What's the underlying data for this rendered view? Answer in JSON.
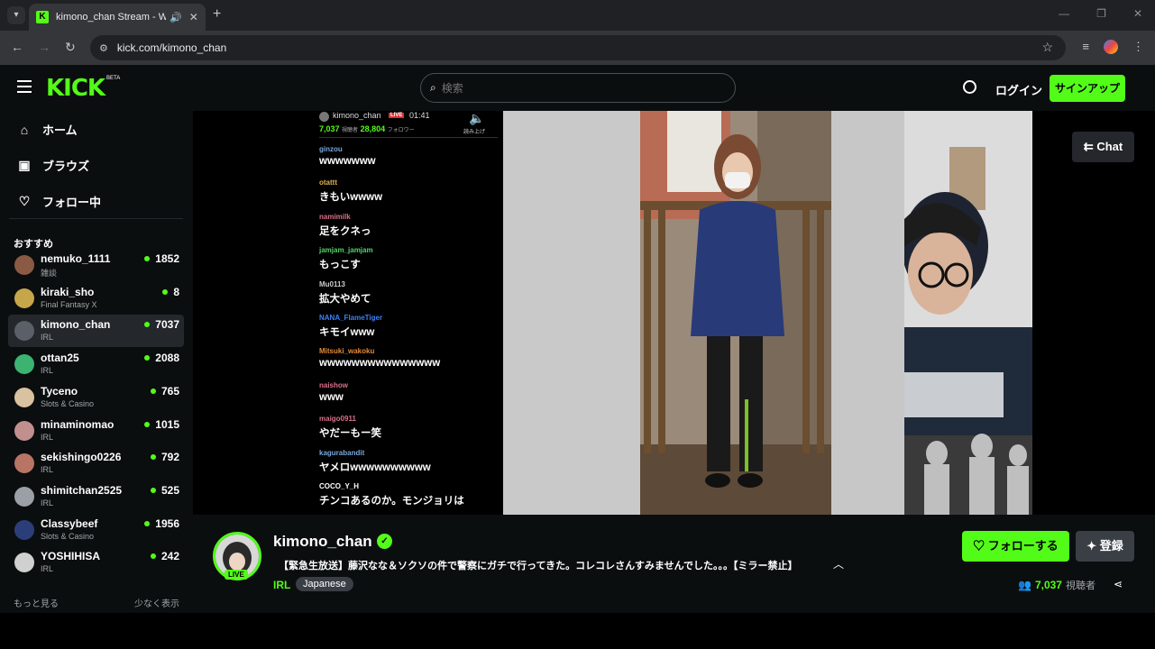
{
  "browser": {
    "tab_title": "kimono_chan Stream - Watch Live on Kick",
    "url": "kick.com/kimono_chan"
  },
  "header": {
    "logo": "KICK",
    "beta": "BETA",
    "search_placeholder": "検索",
    "login": "ログイン",
    "signup": "サインアップ"
  },
  "sidebar": {
    "nav": [
      {
        "label": "ホーム",
        "icon": "home-icon"
      },
      {
        "label": "ブラウズ",
        "icon": "browse-icon"
      },
      {
        "label": "フォロー中",
        "icon": "heart-icon"
      }
    ],
    "recommended_title": "おすすめ",
    "channels": [
      {
        "name": "nemuko_1111",
        "category": "雑談",
        "viewers": "1852",
        "color": "#8a5a44"
      },
      {
        "name": "kiraki_sho",
        "category": "Final Fantasy X",
        "viewers": "8",
        "color": "#c7a64a"
      },
      {
        "name": "kimono_chan",
        "category": "IRL",
        "viewers": "7037",
        "color": "#5a5f68",
        "active": true
      },
      {
        "name": "ottan25",
        "category": "IRL",
        "viewers": "2088",
        "color": "#3cb371"
      },
      {
        "name": "Tyceno",
        "category": "Slots & Casino",
        "viewers": "765",
        "color": "#d9c2a0"
      },
      {
        "name": "minaminomao",
        "category": "IRL",
        "viewers": "1015",
        "color": "#c28f8f"
      },
      {
        "name": "sekishingo0226",
        "category": "IRL",
        "viewers": "792",
        "color": "#b87464"
      },
      {
        "name": "shimitchan2525",
        "category": "IRL",
        "viewers": "525",
        "color": "#9aa0a6"
      },
      {
        "name": "Classybeef",
        "category": "Slots & Casino",
        "viewers": "1956",
        "color": "#2c3e7a"
      },
      {
        "name": "YOSHIHISA",
        "category": "IRL",
        "viewers": "242",
        "color": "#d0d0d0"
      }
    ],
    "show_more": "もっと見る",
    "show_less": "少なく表示"
  },
  "overlay_chat": {
    "streamer": "kimono_chan",
    "live": "LIVE",
    "time": "01:41",
    "viewers": "7,037",
    "viewers_label": "視聴者",
    "followers": "28,804",
    "followers_label": "フォロワー",
    "speaker_label": "読み上げ",
    "messages": [
      {
        "user": "ginzou",
        "text": "wwwwwww",
        "color": "#7aa7d9"
      },
      {
        "user": "otattt",
        "text": "きもいwwww",
        "color": "#e0b24a"
      },
      {
        "user": "namimilk",
        "text": "足をクネっ",
        "color": "#d9708a"
      },
      {
        "user": "jamjam_jamjam",
        "text": "もっこす",
        "color": "#53d46b"
      },
      {
        "user": "Mu0113",
        "text": "拡大やめて",
        "color": "#cccccc"
      },
      {
        "user": "NANA_FlameTiger",
        "text": "キモイwww",
        "color": "#3b82f6"
      },
      {
        "user": "Mitsuki_wakoku",
        "text": "wwwwwwwwwwwwwww",
        "color": "#e08a3b"
      },
      {
        "user": "naishow",
        "text": "www",
        "color": "#d9708a"
      },
      {
        "user": "maigo0911",
        "text": "やだーもー笑",
        "color": "#d9708a"
      },
      {
        "user": "kagurabandit",
        "text": "ヤメロwwwwwwwwww",
        "color": "#7aa7d9"
      },
      {
        "user": "COCO_Y_H",
        "text": "チンコあるのか。モンジョリは",
        "color": "#ffffff"
      }
    ]
  },
  "player": {
    "chat_button": "Chat"
  },
  "stream": {
    "name": "kimono_chan",
    "live_badge": "LIVE",
    "title": "【緊急生放送】藤沢なな＆ソクソの件で警察にガチで行ってきた。コレコレさんすみませんでした。。。【ミラー禁止】",
    "category": "IRL",
    "tag": "Japanese",
    "follow": "フォローする",
    "subscribe": "登録",
    "viewers": "7,037",
    "viewers_label": "視聴者"
  },
  "colors": {
    "accent": "#53fc18",
    "bg": "#0b0e0f"
  }
}
